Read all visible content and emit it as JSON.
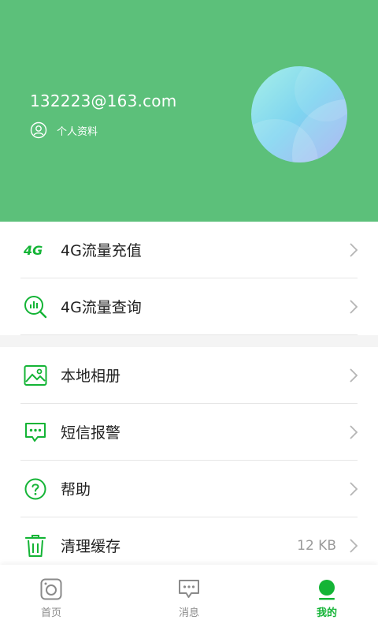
{
  "profile": {
    "email": "132223@163.com",
    "profile_link_label": "个人资料"
  },
  "menu": {
    "items": [
      {
        "label": "4G流量充值",
        "icon": "4g-icon"
      },
      {
        "label": "4G流量查询",
        "icon": "search-chart-icon"
      },
      {
        "label": "本地相册",
        "icon": "photo-album-icon"
      },
      {
        "label": "短信报警",
        "icon": "sms-alert-icon"
      },
      {
        "label": "帮助",
        "icon": "help-icon"
      },
      {
        "label": "清理缓存",
        "icon": "trash-icon",
        "value": "12 KB"
      }
    ]
  },
  "tabbar": {
    "tabs": [
      {
        "label": "首页",
        "icon": "camera-icon",
        "active": false
      },
      {
        "label": "消息",
        "icon": "message-icon",
        "active": false
      },
      {
        "label": "我的",
        "icon": "profile-dot-icon",
        "active": true
      }
    ]
  },
  "colors": {
    "header_bg": "#5cc07a",
    "accent": "#14b436"
  }
}
